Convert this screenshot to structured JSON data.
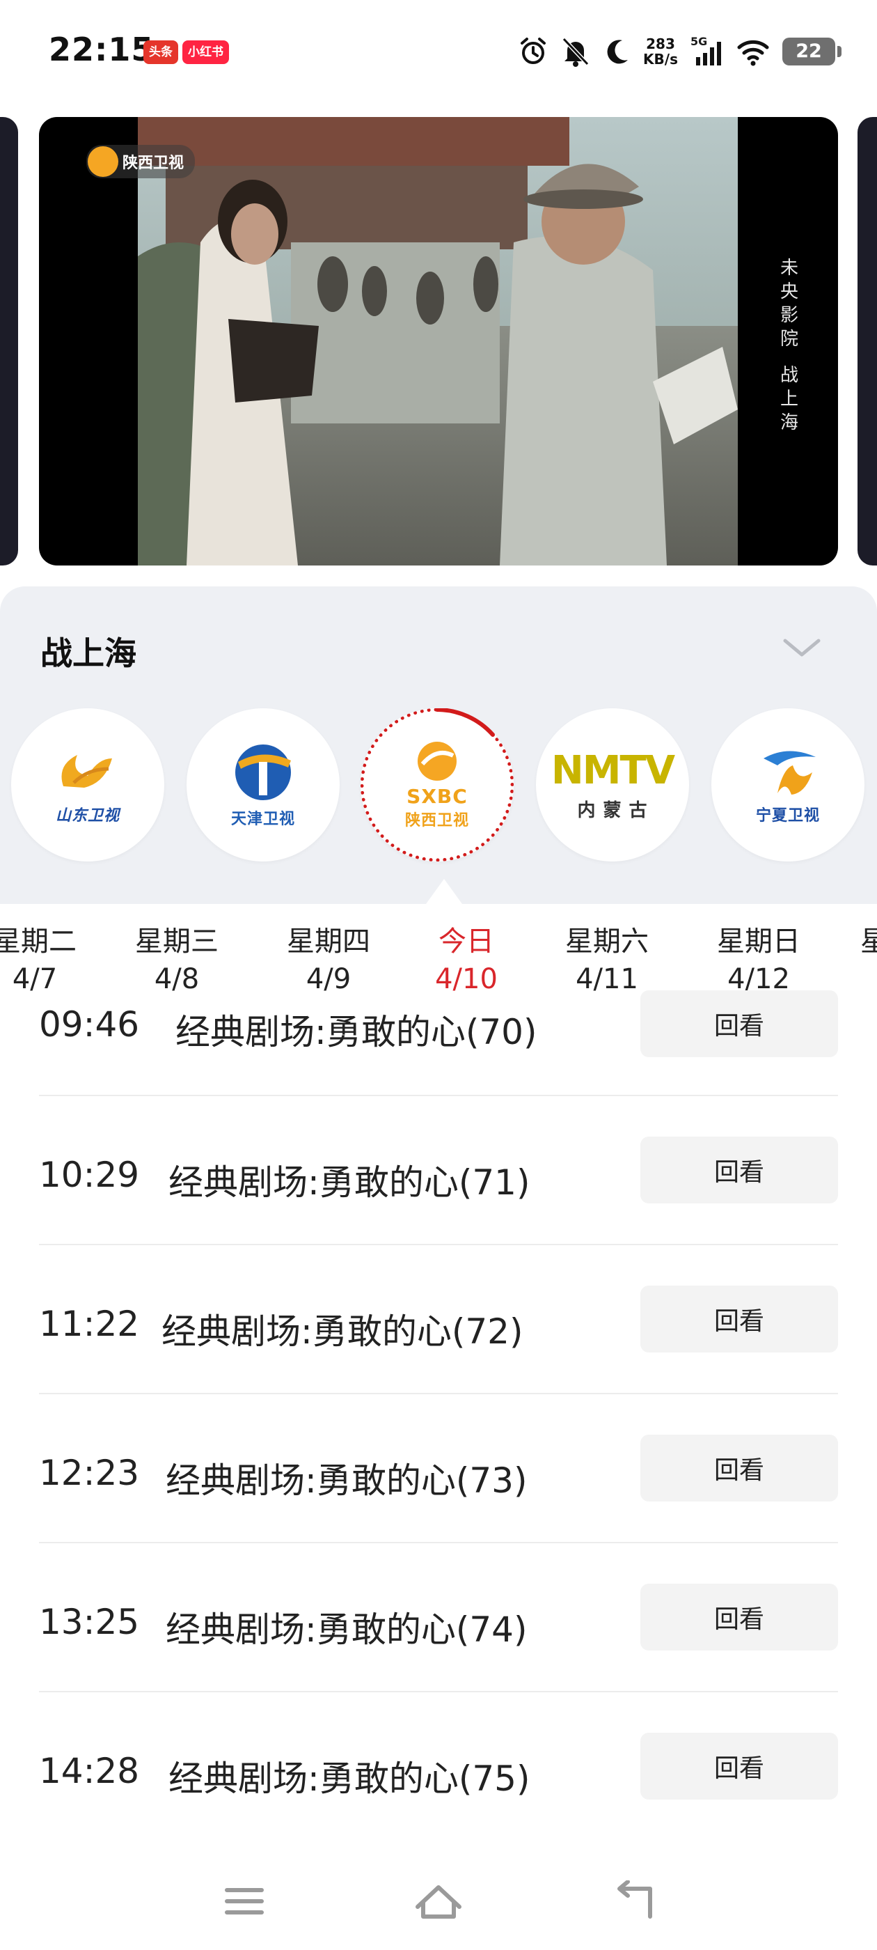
{
  "status_bar": {
    "time": "22:15",
    "badge_toutiao": "头条",
    "badge_xhs": "小红书",
    "net_speed_value": "283",
    "net_speed_unit": "KB/s",
    "network_type": "5G",
    "battery": "22",
    "icons": [
      "alarm-icon",
      "bell-off-icon",
      "moon-icon",
      "signal-icon",
      "wifi-icon",
      "battery-icon"
    ]
  },
  "video": {
    "channel_bug": "陕西卫视",
    "caption_line1": "未央影院",
    "caption_line2": "战上海"
  },
  "program": {
    "title": "战上海"
  },
  "channels": [
    {
      "name": "山东卫视",
      "active": false
    },
    {
      "name": "天津卫视",
      "active": false
    },
    {
      "name": "陕西卫视",
      "logo_text": "SXBC",
      "active": true
    },
    {
      "name": "内 蒙 古",
      "logo_text": "NMTV",
      "active": false
    },
    {
      "name": "宁夏卫视",
      "active": false
    }
  ],
  "days": [
    {
      "weekday": "星期二",
      "date": "4/7"
    },
    {
      "weekday": "星期三",
      "date": "4/8"
    },
    {
      "weekday": "星期四",
      "date": "4/9"
    },
    {
      "weekday": "今日",
      "date": "4/10",
      "active": true
    },
    {
      "weekday": "星期六",
      "date": "4/11"
    },
    {
      "weekday": "星期日",
      "date": "4/12"
    },
    {
      "weekday": "星",
      "date": ""
    }
  ],
  "schedule": [
    {
      "time": "09:46",
      "name": "经典剧场:勇敢的心(70)",
      "action": "回看"
    },
    {
      "time": "10:29",
      "name": "经典剧场:勇敢的心(71)",
      "action": "回看"
    },
    {
      "time": "11:22",
      "name": "经典剧场:勇敢的心(72)",
      "action": "回看"
    },
    {
      "time": "12:23",
      "name": "经典剧场:勇敢的心(73)",
      "action": "回看"
    },
    {
      "time": "13:25",
      "name": "经典剧场:勇敢的心(74)",
      "action": "回看"
    },
    {
      "time": "14:28",
      "name": "经典剧场:勇敢的心(75)",
      "action": "回看"
    }
  ],
  "colors": {
    "accent": "#d9262b",
    "panel_bg": "#eef0f4",
    "button_bg": "#f3f3f3"
  }
}
